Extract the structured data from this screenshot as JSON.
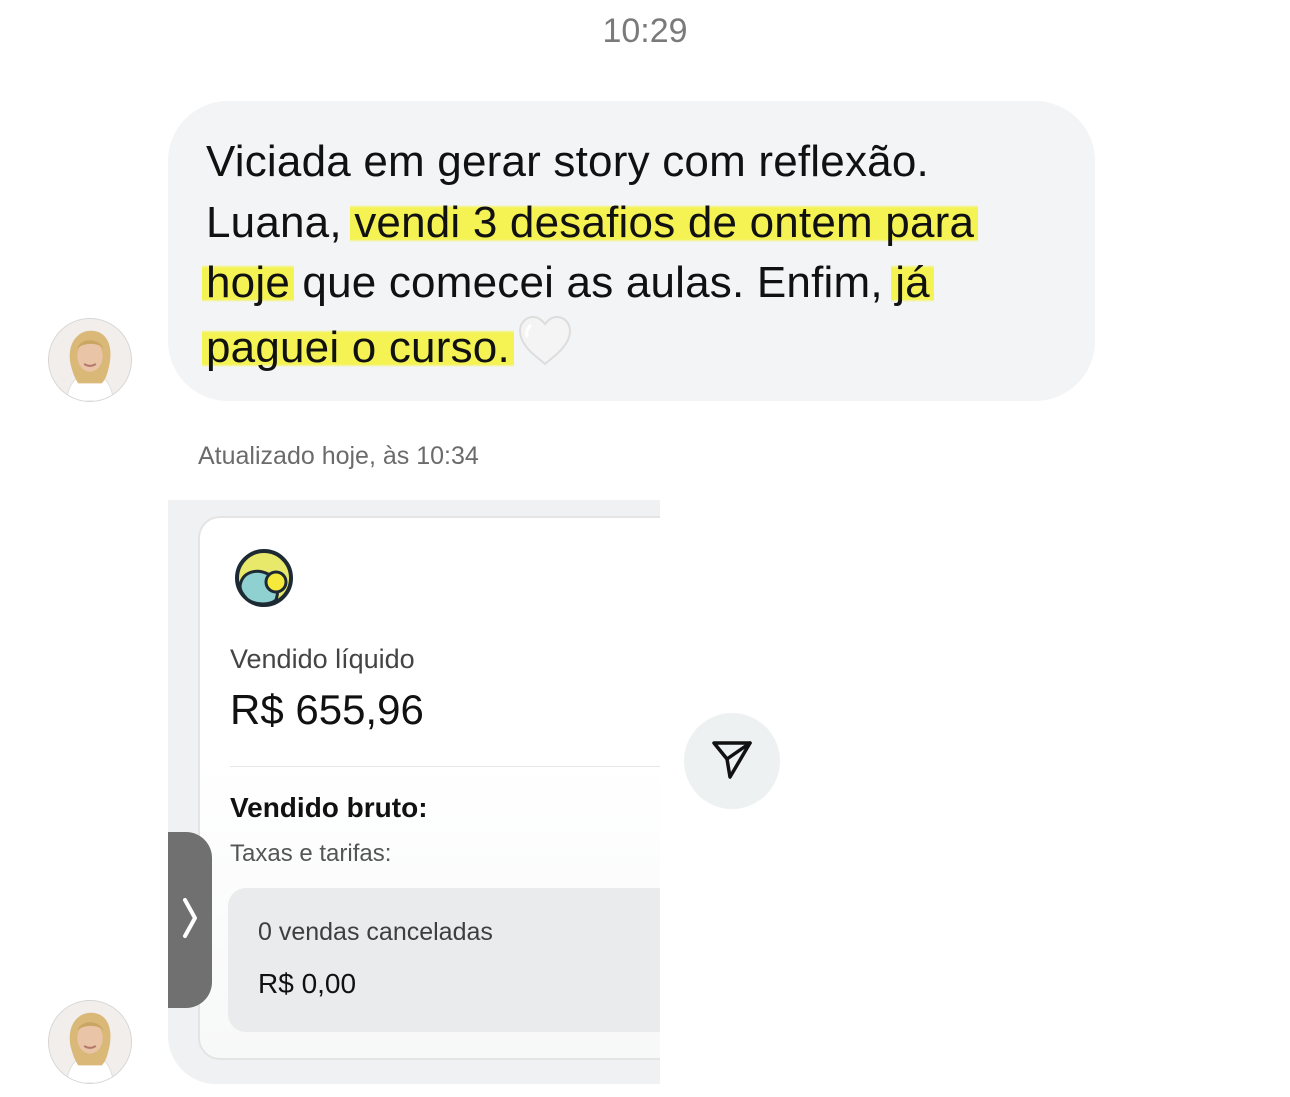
{
  "chat": {
    "timestamp": "10:29",
    "message": {
      "line1": "Viciada em gerar story com reflexão.",
      "line2_prefix": "Luana, ",
      "highlight_a": "vendi 3 desafios de ontem para",
      "highlight_b": "hoje",
      "middle": " que comecei as aulas. Enfim, ",
      "highlight_c": "já",
      "highlight_d": "paguei o curso.",
      "heart_icon": "white-heart-icon",
      "highlight_color": "#f4f34a"
    },
    "updated_label": "Atualizado hoje, às 10:34"
  },
  "sales_card": {
    "logo_icon": "circles-logo-icon",
    "net_label": "Vendido líquido",
    "net_value": "R$ 655,96",
    "gross_label": "Vendido bruto:",
    "fees_label": "Taxas e tarifas:",
    "cancelled_count": "0 vendas canceladas",
    "cancelled_value": "R$ 0,00",
    "expand_icon": "chevron-right-icon"
  },
  "actions": {
    "share_icon": "paper-plane-icon"
  }
}
